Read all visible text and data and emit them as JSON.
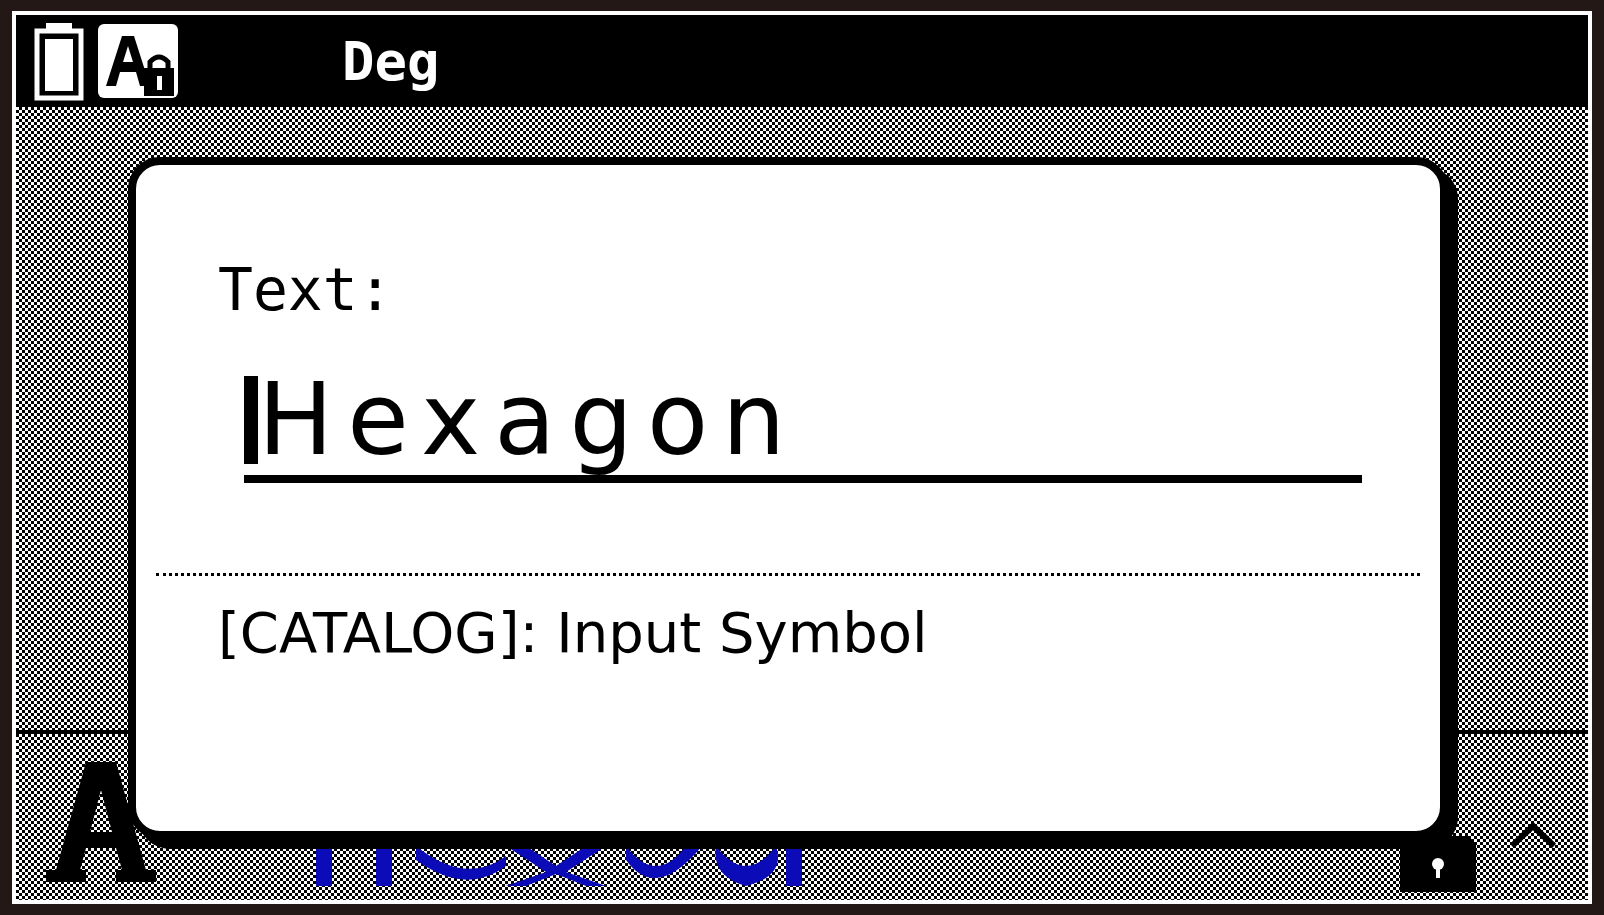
{
  "status_bar": {
    "angle_unit": "Deg",
    "input_lock": true
  },
  "dialog": {
    "label": "Text:",
    "value": "Hexagon",
    "hint": "[CATALOG]: Input Symbol"
  }
}
